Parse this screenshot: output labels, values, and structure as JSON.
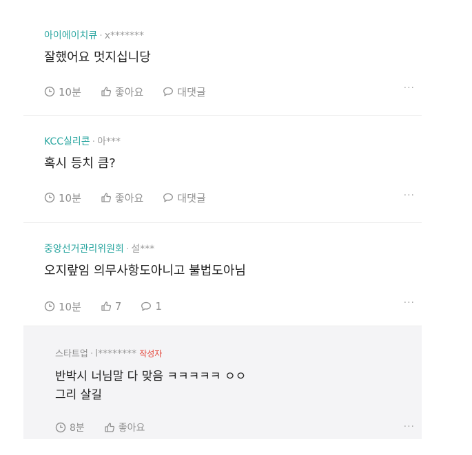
{
  "comments": [
    {
      "author": "아이에이치큐",
      "masked_user": "x*******",
      "text": "잘했어요 멋지십니당",
      "time": "10분",
      "like": "좋아요",
      "reply": "대댓글",
      "more": "···"
    },
    {
      "author": "KCC실리콘",
      "masked_user": "아***",
      "text": "혹시 등치 큼?",
      "time": "10분",
      "like": "좋아요",
      "reply": "대댓글",
      "more": "···"
    },
    {
      "author": "중앙선거관리위원회",
      "masked_user": "설***",
      "text": "오지랖임 의무사항도아니고 불법도아님",
      "time": "10분",
      "like": "7",
      "reply": "1",
      "more": "···"
    },
    {
      "author": "스타트업",
      "masked_user": "l********",
      "badge": "작성자",
      "text_line1": "반박시 너님말 다 맞음 ㅋㅋㅋㅋㅋ ㅇㅇ",
      "text_line2": "그리 살길",
      "time": "8분",
      "like": "좋아요",
      "more": "···"
    }
  ],
  "separator": "·",
  "colors": {
    "author": "#2aa6a0",
    "badge": "#e4473c",
    "reply_bg": "#f4f4f6",
    "meta": "#8f8f8f"
  },
  "icons": {
    "time": "clock-icon",
    "like": "thumbs-up-icon",
    "reply": "speech-bubble-icon",
    "more": "more-dots-icon"
  }
}
